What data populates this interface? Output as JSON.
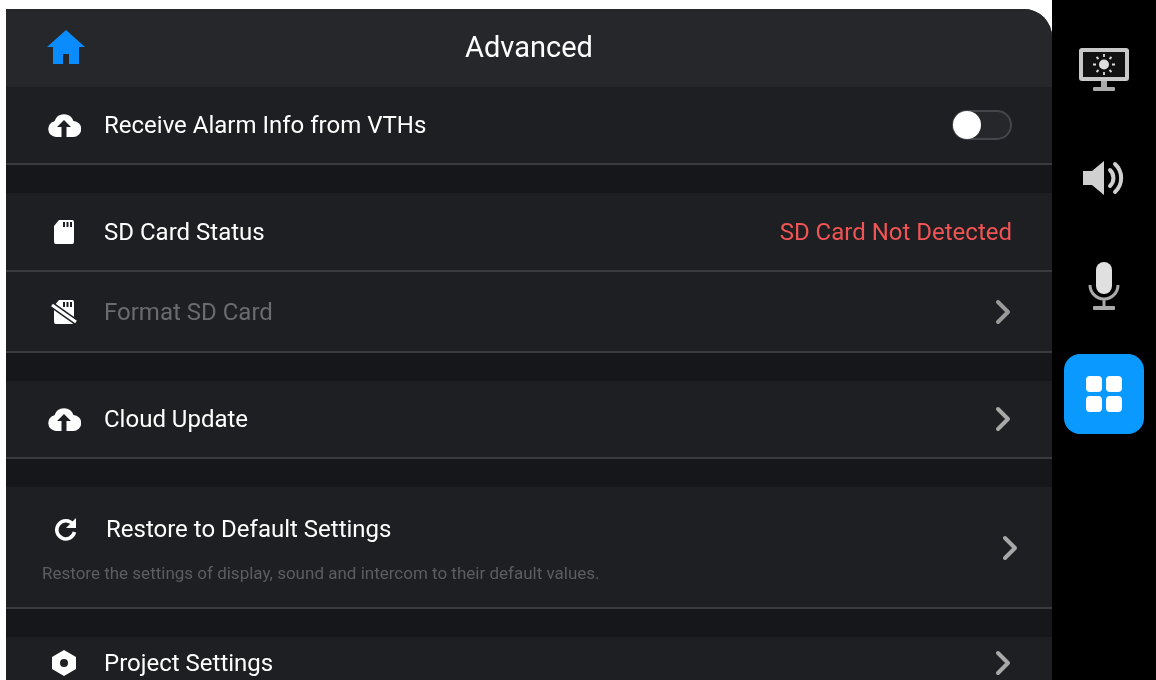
{
  "header": {
    "title": "Advanced"
  },
  "groups": [
    {
      "rows": [
        {
          "kind": "toggle",
          "label": "Receive Alarm Info from VTHs",
          "on": false,
          "disabled": false
        }
      ]
    },
    {
      "rows": [
        {
          "kind": "value",
          "label": "SD Card Status",
          "value": "SD Card Not Detected",
          "disabled": false
        },
        {
          "kind": "link",
          "label": "Format SD Card",
          "disabled": true
        }
      ]
    },
    {
      "rows": [
        {
          "kind": "link",
          "label": "Cloud Update",
          "disabled": false
        }
      ]
    },
    {
      "rows": [
        {
          "kind": "link",
          "label": "Restore to Default Settings",
          "description": "Restore the settings of display, sound and intercom to their default values.",
          "disabled": false
        }
      ]
    },
    {
      "rows": [
        {
          "kind": "link",
          "label": "Project Settings",
          "disabled": false
        }
      ]
    }
  ],
  "sidebar": {
    "items": [
      {
        "selected": false
      },
      {
        "selected": false
      },
      {
        "selected": false
      },
      {
        "selected": true
      }
    ]
  }
}
